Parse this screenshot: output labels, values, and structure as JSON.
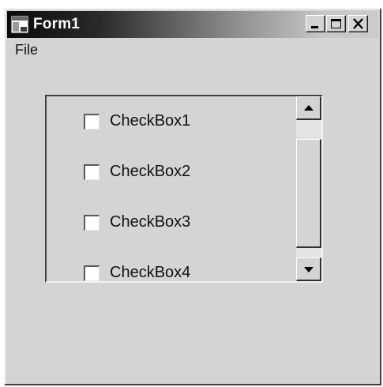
{
  "window": {
    "title": "Form1"
  },
  "menu": {
    "items": [
      {
        "label": "File"
      }
    ]
  },
  "checkboxes": [
    {
      "label": "CheckBox1",
      "checked": false
    },
    {
      "label": "CheckBox2",
      "checked": false
    },
    {
      "label": "CheckBox3",
      "checked": false
    },
    {
      "label": "CheckBox4",
      "checked": false
    }
  ],
  "icons": {
    "app": "form-app-icon",
    "minimize": "minimize-icon",
    "maximize": "maximize-icon",
    "close": "close-icon",
    "scroll_up": "arrow-up-icon",
    "scroll_down": "arrow-down-icon"
  },
  "colors": {
    "face": "#d4d4d4",
    "title_dark": "#0a0a0a",
    "title_light": "#cccccc",
    "scroll_track": "#e3e3e3"
  }
}
